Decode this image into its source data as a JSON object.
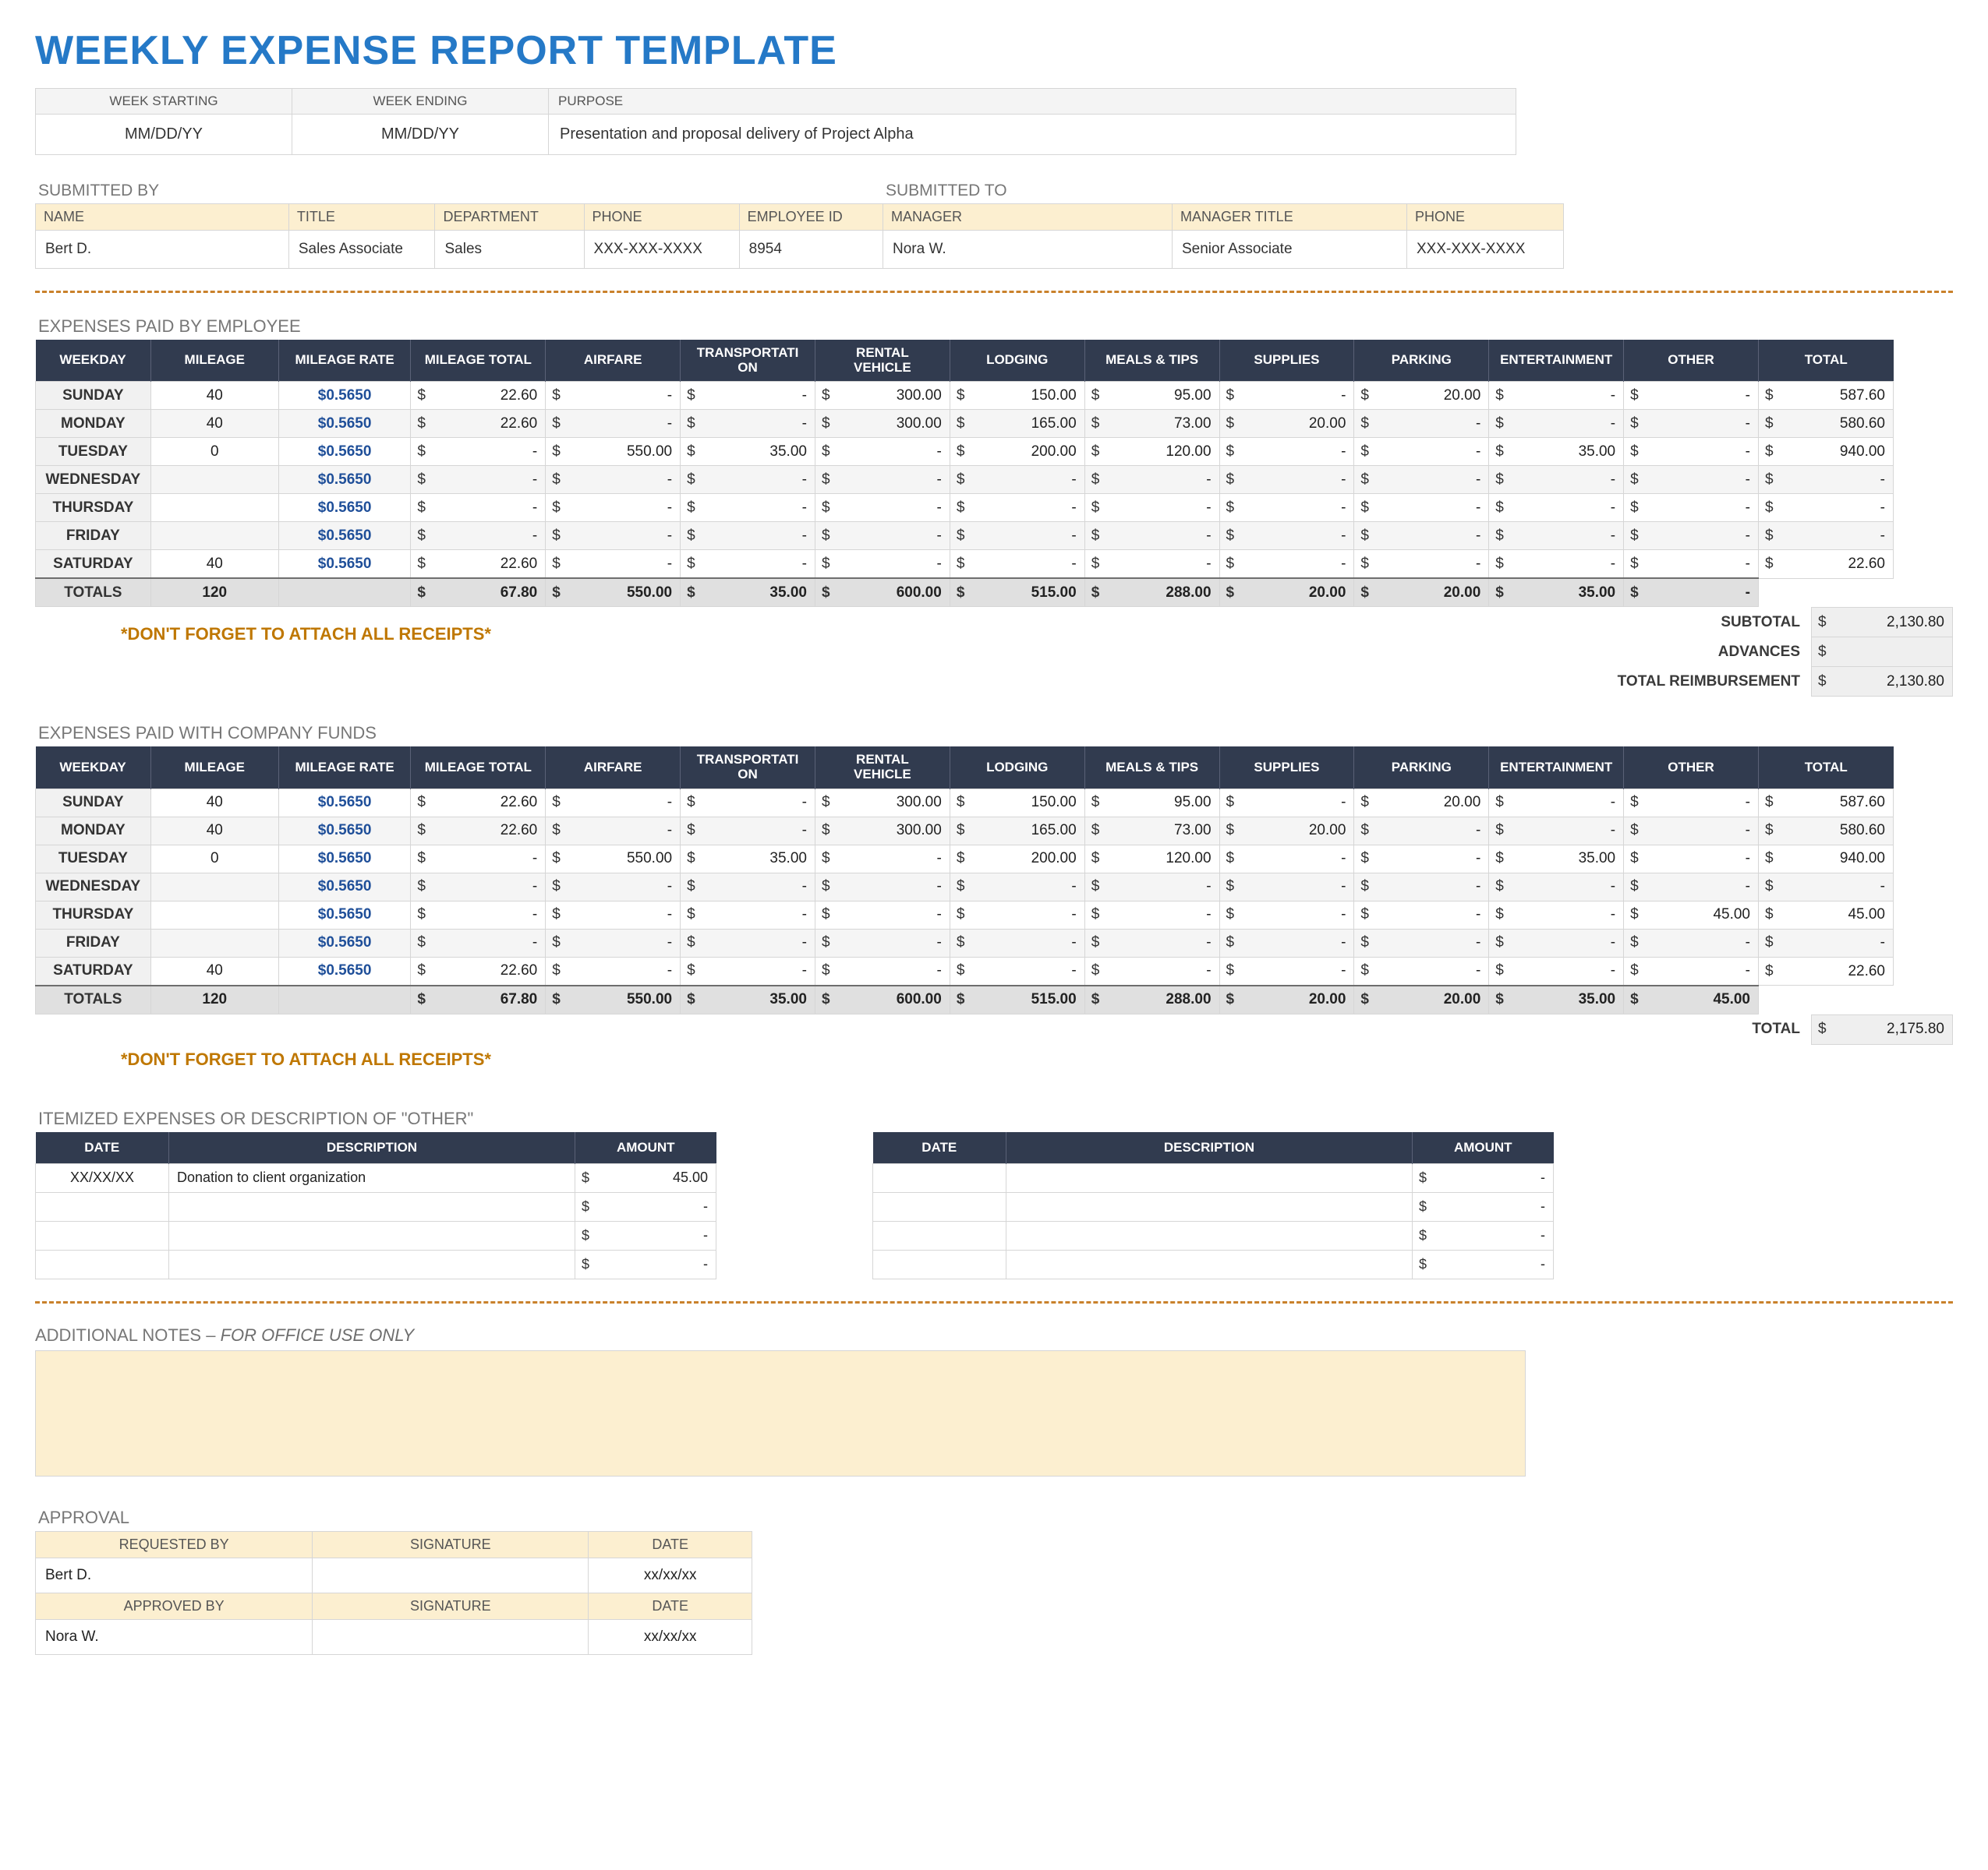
{
  "title": "WEEKLY EXPENSE REPORT TEMPLATE",
  "info": {
    "headers": [
      "WEEK STARTING",
      "WEEK ENDING",
      "PURPOSE"
    ],
    "values": [
      "MM/DD/YY",
      "MM/DD/YY",
      "Presentation and proposal delivery of Project Alpha"
    ]
  },
  "submitted_by": {
    "caption": "SUBMITTED BY",
    "headers": [
      "NAME",
      "TITLE",
      "DEPARTMENT",
      "PHONE",
      "EMPLOYEE ID"
    ],
    "values": [
      "Bert D.",
      "Sales Associate",
      "Sales",
      "XXX-XXX-XXXX",
      "8954"
    ]
  },
  "submitted_to": {
    "caption": "SUBMITTED TO",
    "headers": [
      "MANAGER",
      "MANAGER TITLE",
      "PHONE"
    ],
    "values": [
      "Nora W.",
      "Senior Associate",
      "XXX-XXX-XXXX"
    ]
  },
  "exp": {
    "headers": [
      "WEEKDAY",
      "MILEAGE",
      "MILEAGE RATE",
      "MILEAGE TOTAL",
      "AIRFARE",
      "TRANSPORTATION",
      "RENTAL VEHICLE",
      "LODGING",
      "MEALS & TIPS",
      "SUPPLIES",
      "PARKING",
      "ENTERTAINMENT",
      "OTHER",
      "TOTAL"
    ],
    "totals_label": "TOTALS",
    "rate": "$0.5650"
  },
  "exp_employee": {
    "title": "EXPENSES PAID BY EMPLOYEE",
    "rows": [
      {
        "day": "SUNDAY",
        "mileage": "40",
        "mt": "22.60",
        "air": "-",
        "trans": "-",
        "rent": "300.00",
        "lodg": "150.00",
        "meals": "95.00",
        "supp": "-",
        "park": "20.00",
        "ent": "-",
        "other": "-",
        "total": "587.60"
      },
      {
        "day": "MONDAY",
        "mileage": "40",
        "mt": "22.60",
        "air": "-",
        "trans": "-",
        "rent": "300.00",
        "lodg": "165.00",
        "meals": "73.00",
        "supp": "20.00",
        "park": "-",
        "ent": "-",
        "other": "-",
        "total": "580.60"
      },
      {
        "day": "TUESDAY",
        "mileage": "0",
        "mt": "-",
        "air": "550.00",
        "trans": "35.00",
        "rent": "-",
        "lodg": "200.00",
        "meals": "120.00",
        "supp": "-",
        "park": "-",
        "ent": "35.00",
        "other": "-",
        "total": "940.00"
      },
      {
        "day": "WEDNESDAY",
        "mileage": "",
        "mt": "-",
        "air": "-",
        "trans": "-",
        "rent": "-",
        "lodg": "-",
        "meals": "-",
        "supp": "-",
        "park": "-",
        "ent": "-",
        "other": "-",
        "total": "-"
      },
      {
        "day": "THURSDAY",
        "mileage": "",
        "mt": "-",
        "air": "-",
        "trans": "-",
        "rent": "-",
        "lodg": "-",
        "meals": "-",
        "supp": "-",
        "park": "-",
        "ent": "-",
        "other": "-",
        "total": "-"
      },
      {
        "day": "FRIDAY",
        "mileage": "",
        "mt": "-",
        "air": "-",
        "trans": "-",
        "rent": "-",
        "lodg": "-",
        "meals": "-",
        "supp": "-",
        "park": "-",
        "ent": "-",
        "other": "-",
        "total": "-"
      },
      {
        "day": "SATURDAY",
        "mileage": "40",
        "mt": "22.60",
        "air": "-",
        "trans": "-",
        "rent": "-",
        "lodg": "-",
        "meals": "-",
        "supp": "-",
        "park": "-",
        "ent": "-",
        "other": "-",
        "total": "22.60"
      }
    ],
    "totals": {
      "mileage": "120",
      "mt": "67.80",
      "air": "550.00",
      "trans": "35.00",
      "rent": "600.00",
      "lodg": "515.00",
      "meals": "288.00",
      "supp": "20.00",
      "park": "20.00",
      "ent": "35.00",
      "other": "-",
      "total": ""
    },
    "summary": [
      {
        "label": "SUBTOTAL",
        "value": "2,130.80"
      },
      {
        "label": "ADVANCES",
        "value": ""
      },
      {
        "label": "TOTAL REIMBURSEMENT",
        "value": "2,130.80"
      }
    ]
  },
  "exp_company": {
    "title": "EXPENSES PAID WITH COMPANY FUNDS",
    "rows": [
      {
        "day": "SUNDAY",
        "mileage": "40",
        "mt": "22.60",
        "air": "-",
        "trans": "-",
        "rent": "300.00",
        "lodg": "150.00",
        "meals": "95.00",
        "supp": "-",
        "park": "20.00",
        "ent": "-",
        "other": "-",
        "total": "587.60"
      },
      {
        "day": "MONDAY",
        "mileage": "40",
        "mt": "22.60",
        "air": "-",
        "trans": "-",
        "rent": "300.00",
        "lodg": "165.00",
        "meals": "73.00",
        "supp": "20.00",
        "park": "-",
        "ent": "-",
        "other": "-",
        "total": "580.60"
      },
      {
        "day": "TUESDAY",
        "mileage": "0",
        "mt": "-",
        "air": "550.00",
        "trans": "35.00",
        "rent": "-",
        "lodg": "200.00",
        "meals": "120.00",
        "supp": "-",
        "park": "-",
        "ent": "35.00",
        "other": "-",
        "total": "940.00"
      },
      {
        "day": "WEDNESDAY",
        "mileage": "",
        "mt": "-",
        "air": "-",
        "trans": "-",
        "rent": "-",
        "lodg": "-",
        "meals": "-",
        "supp": "-",
        "park": "-",
        "ent": "-",
        "other": "-",
        "total": "-"
      },
      {
        "day": "THURSDAY",
        "mileage": "",
        "mt": "-",
        "air": "-",
        "trans": "-",
        "rent": "-",
        "lodg": "-",
        "meals": "-",
        "supp": "-",
        "park": "-",
        "ent": "-",
        "other": "45.00",
        "total": "45.00"
      },
      {
        "day": "FRIDAY",
        "mileage": "",
        "mt": "-",
        "air": "-",
        "trans": "-",
        "rent": "-",
        "lodg": "-",
        "meals": "-",
        "supp": "-",
        "park": "-",
        "ent": "-",
        "other": "-",
        "total": "-"
      },
      {
        "day": "SATURDAY",
        "mileage": "40",
        "mt": "22.60",
        "air": "-",
        "trans": "-",
        "rent": "-",
        "lodg": "-",
        "meals": "-",
        "supp": "-",
        "park": "-",
        "ent": "-",
        "other": "-",
        "total": "22.60"
      }
    ],
    "totals": {
      "mileage": "120",
      "mt": "67.80",
      "air": "550.00",
      "trans": "35.00",
      "rent": "600.00",
      "lodg": "515.00",
      "meals": "288.00",
      "supp": "20.00",
      "park": "20.00",
      "ent": "35.00",
      "other": "45.00",
      "total": ""
    },
    "summary": [
      {
        "label": "TOTAL",
        "value": "2,175.80"
      }
    ]
  },
  "receipts": "*DON'T FORGET TO ATTACH ALL RECEIPTS*",
  "itemized": {
    "title": "ITEMIZED EXPENSES OR DESCRIPTION OF \"OTHER\"",
    "headers": [
      "DATE",
      "DESCRIPTION",
      "AMOUNT"
    ],
    "left_rows": [
      {
        "date": "XX/XX/XX",
        "desc": "Donation to client organization",
        "amt": "45.00"
      },
      {
        "date": "",
        "desc": "",
        "amt": "-"
      },
      {
        "date": "",
        "desc": "",
        "amt": "-"
      },
      {
        "date": "",
        "desc": "",
        "amt": "-"
      }
    ],
    "right_rows": [
      {
        "date": "",
        "desc": "",
        "amt": "-"
      },
      {
        "date": "",
        "desc": "",
        "amt": "-"
      },
      {
        "date": "",
        "desc": "",
        "amt": "-"
      },
      {
        "date": "",
        "desc": "",
        "amt": "-"
      }
    ]
  },
  "notes": {
    "label": "ADDITIONAL NOTES – ",
    "ital": "FOR OFFICE USE ONLY"
  },
  "approval": {
    "title": "APPROVAL",
    "rows": [
      {
        "h": [
          "REQUESTED BY",
          "SIGNATURE",
          "DATE"
        ],
        "v": [
          "Bert D.",
          "",
          "xx/xx/xx"
        ]
      },
      {
        "h": [
          "APPROVED BY",
          "SIGNATURE",
          "DATE"
        ],
        "v": [
          "Nora W.",
          "",
          "xx/xx/xx"
        ]
      }
    ]
  }
}
